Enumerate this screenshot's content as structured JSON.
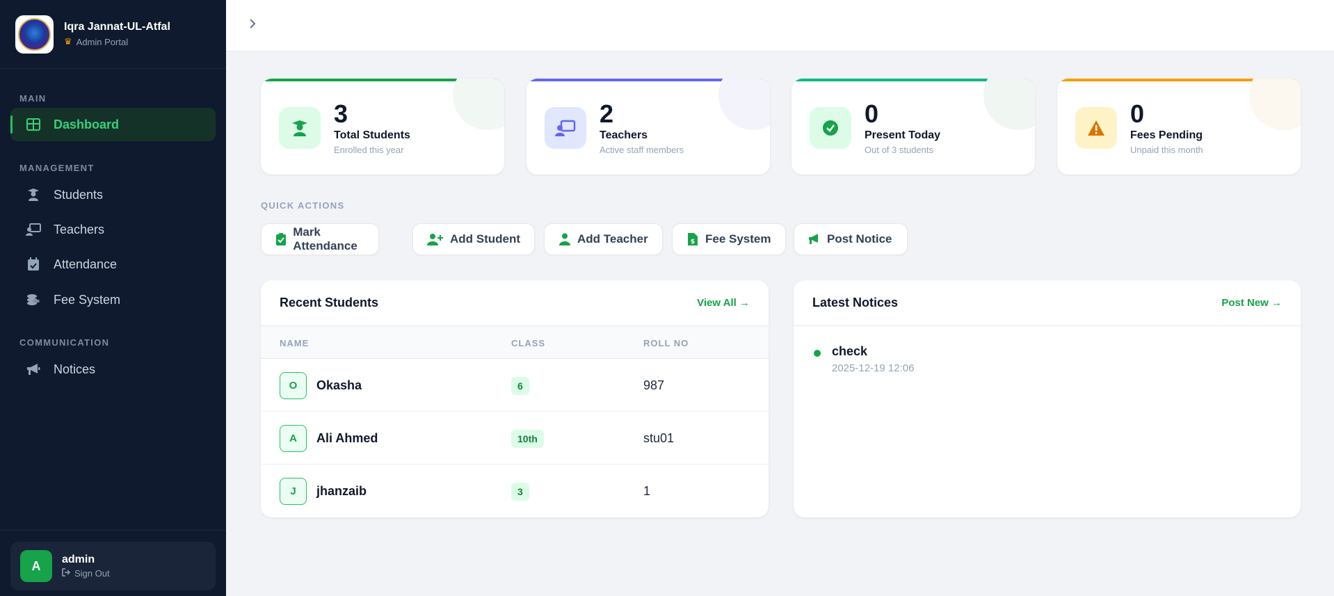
{
  "sidebar": {
    "brand": {
      "name": "Iqra Jannat-UL-Atfal",
      "subtitle": "Admin Portal"
    },
    "sections": {
      "main": "MAIN",
      "management": "MANAGEMENT",
      "communication": "COMMUNICATION"
    },
    "items": {
      "dashboard": "Dashboard",
      "students": "Students",
      "teachers": "Teachers",
      "attendance": "Attendance",
      "fee_system": "Fee System",
      "notices": "Notices"
    },
    "user": {
      "initial": "A",
      "name": "admin",
      "sign_out": "Sign Out"
    }
  },
  "stats": [
    {
      "value": "3",
      "label": "Total Students",
      "sub": "Enrolled this year",
      "color": "#16a34a",
      "icon": "graduation-icon"
    },
    {
      "value": "2",
      "label": "Teachers",
      "sub": "Active staff members",
      "color": "#6366f1",
      "icon": "teacher-board-icon"
    },
    {
      "value": "0",
      "label": "Present Today",
      "sub": "Out of 3 students",
      "color": "#10b981",
      "icon": "check-circle-icon"
    },
    {
      "value": "0",
      "label": "Fees Pending",
      "sub": "Unpaid this month",
      "color": "#f59e0b",
      "icon": "warning-icon"
    }
  ],
  "quick_actions": {
    "title": "QUICK ACTIONS",
    "buttons": {
      "mark_attendance": "Mark Attendance",
      "add_student": "Add Student",
      "add_teacher": "Add Teacher",
      "fee_system": "Fee System",
      "post_notice": "Post Notice"
    }
  },
  "recent_students": {
    "title": "Recent Students",
    "link": "View All →",
    "columns": {
      "name": "NAME",
      "class": "CLASS",
      "roll": "ROLL NO"
    },
    "rows": [
      {
        "initial": "O",
        "name": "Okasha",
        "class": "6",
        "roll": "987"
      },
      {
        "initial": "A",
        "name": "Ali Ahmed",
        "class": "10th",
        "roll": "stu01"
      },
      {
        "initial": "J",
        "name": "jhanzaib",
        "class": "3",
        "roll": "1"
      }
    ]
  },
  "notices": {
    "title": "Latest Notices",
    "link": "Post New →",
    "items": [
      {
        "title": "check",
        "date": "2025-12-19 12:06"
      }
    ]
  },
  "colors": {
    "accent": "#16a34a",
    "sidebar_bg": "#0f1a2e",
    "page_bg": "#f1f3f7"
  }
}
